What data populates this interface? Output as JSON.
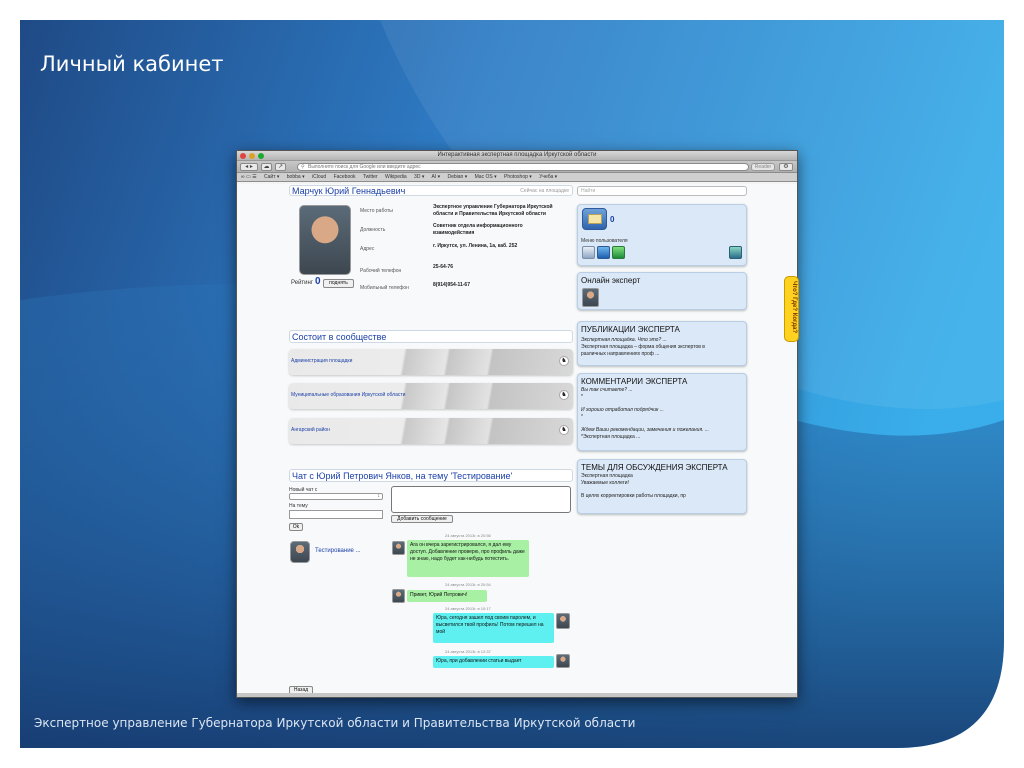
{
  "slide": {
    "title": "Личный кабинет",
    "footer": "Экспертное управление Губернатора Иркутской области и Правительства Иркутской области"
  },
  "browser": {
    "window_title": "Интерактивная экспертная площадка Иркутской области",
    "search_placeholder": "Выполните поиск для Google или введите адрес",
    "reader_label": "Reader",
    "bookmarks": [
      "Сайт ▾",
      "bobba ▾",
      "iCloud",
      "Facebook",
      "Twitter",
      "Wikipedia",
      "3D ▾",
      "AI ▾",
      "Debian ▾",
      "Mac OS ▾",
      "Photoshop ▾",
      "Учеба ▾"
    ],
    "colors": {
      "close": "#e0443e",
      "minimize": "#dea123",
      "zoom": "#1aab29"
    }
  },
  "profile": {
    "name": "Марчук Юрий Геннадьевич",
    "status": "Сейчас на площадке",
    "rating_label": "Рейтинг",
    "rating_value": "0",
    "raise_button": "поднять",
    "fields": [
      {
        "label": "Место работы",
        "value": "Экспертное управление Губернатора Иркутской области и Правительства Иркутской области"
      },
      {
        "label": "Должность",
        "value": "Советник отдела информационного взаимодействия"
      },
      {
        "label": "Адрес",
        "value": "г. Иркутск, ул. Ленина, 1а, каб. 252"
      },
      {
        "label": "Рабочий телефон",
        "value": "25-64-76"
      },
      {
        "label": "Мобильный телефон",
        "value": "8(914)954-11-67"
      }
    ]
  },
  "search": {
    "placeholder": "Найти"
  },
  "communities": {
    "title": "Состоит в сообществе",
    "items": [
      "Администрация площадки",
      "Муниципальные образования Иркутской области",
      "Ангарский район"
    ]
  },
  "chat": {
    "title": "Чат с Юрий Петрович Янков, на тему 'Тестирование'",
    "new_chat_label": "Новый чат с",
    "topic_label": "На тему",
    "ok_button": "Ok",
    "add_message_button": "Добавить сообщение",
    "thread_label": "Тестирование ...",
    "back_button": "Назад",
    "messages": [
      {
        "time": "24 августа 2013г.  в  20:56",
        "text": "Ага он вчера зарегистрировался, я дал ему доступ. Добавление проверю, про профиль даже не знаю, надо будет как-нибудь потестить.",
        "color": "#a8f0a3"
      },
      {
        "time": "24 августа 2013г.  в  20:54",
        "text": "Привет, Юрий Петрович!",
        "color": "#a8f0a3"
      },
      {
        "time": "24 августа 2013г.  в  10:17",
        "text": "Юра, сегодня зашел под своим паролем, и высветился твой профиль! Потом перешел на мой",
        "color": "#5ef0f0"
      },
      {
        "time": "24 августа 2013г.  в  12:37",
        "text": "Юра, при добавлении статьи выдает",
        "color": "#5ef0f0"
      }
    ]
  },
  "user_menu": {
    "messages_count": "0",
    "label": "Меню пользователя"
  },
  "online_expert": {
    "title": "Онлайн эксперт"
  },
  "publications": {
    "title": "ПУБЛИКАЦИИ ЭКСПЕРТА",
    "lines": [
      "Экспертная площадка. Что это? ...",
      "Экспертная площадка – форма общения экспертов в",
      "различных направлениях проф ..."
    ]
  },
  "comments": {
    "title": "КОММЕНТАРИИ ЭКСПЕРТА",
    "lines": [
      "Вы так считаете? ...",
      "*",
      "И хорошо отработал подрядчик ...",
      "*",
      "Ждем Ваши рекомендации, замечания и пожелания. ...",
      "*Экспертная площадка ..."
    ]
  },
  "topics": {
    "title": "ТЕМЫ ДЛЯ ОБСУЖДЕНИЯ ЭКСПЕРТА",
    "lines": [
      "Экспертная площадка",
      "Уважаемые коллеги!",
      "В целях корректировки работы площадки, пр"
    ]
  },
  "side_tab": {
    "label": "Что? Где? Когда?",
    "color": "#ffd21f"
  }
}
